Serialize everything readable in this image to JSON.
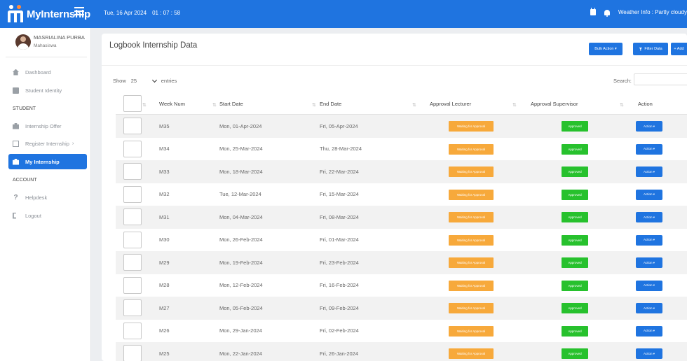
{
  "topbar": {
    "app_name": "MyInternship",
    "date": "Tue, 16 Apr 2024",
    "time": "01 : 07 : 58",
    "weather": "Weather Info : Partly cloudy"
  },
  "profile": {
    "name": "MASRIALINA PURBA",
    "role": "Mahasiswa"
  },
  "sidebar": {
    "items_main": [
      {
        "label": "Dashboard",
        "icon": "home-icon"
      },
      {
        "label": "Student Identity",
        "icon": "id-card-icon"
      }
    ],
    "section_student": "STUDENT",
    "items_student": [
      {
        "label": "Internship Offer",
        "icon": "briefcase-icon"
      },
      {
        "label": "Register Internship",
        "icon": "document-icon",
        "caret": "›"
      },
      {
        "label": "My Internship",
        "icon": "briefcase-icon",
        "active": true
      }
    ],
    "section_account": "ACCOUNT",
    "items_account": [
      {
        "label": "Helpdesk",
        "icon": "question-icon"
      },
      {
        "label": "Logout",
        "icon": "logout-icon"
      }
    ]
  },
  "main": {
    "title": "Logbook Internship Data",
    "bulk_action": "Bulk Action ▾",
    "filter_data": "Filter Data",
    "add": "+ Add",
    "show_label": "Show",
    "entries_value": "25",
    "entries_label": "entries",
    "search_label": "Search:"
  },
  "table": {
    "headers": [
      "Week Num",
      "Start Date",
      "End Date",
      "Approval Lecturer",
      "Approval Supervisor",
      "Action"
    ],
    "sort_glyph": "⇅",
    "status_waiting": "Waiting for Approval",
    "status_approved": "Approved",
    "action_label": "Action ▾",
    "rows": [
      {
        "week": "M35",
        "start": "Mon, 01-Apr-2024",
        "end": "Fri, 05-Apr-2024"
      },
      {
        "week": "M34",
        "start": "Mon, 25-Mar-2024",
        "end": "Thu, 28-Mar-2024"
      },
      {
        "week": "M33",
        "start": "Mon, 18-Mar-2024",
        "end": "Fri, 22-Mar-2024"
      },
      {
        "week": "M32",
        "start": "Tue, 12-Mar-2024",
        "end": "Fri, 15-Mar-2024"
      },
      {
        "week": "M31",
        "start": "Mon, 04-Mar-2024",
        "end": "Fri, 08-Mar-2024"
      },
      {
        "week": "M30",
        "start": "Mon, 26-Feb-2024",
        "end": "Fri, 01-Mar-2024"
      },
      {
        "week": "M29",
        "start": "Mon, 19-Feb-2024",
        "end": "Fri, 23-Feb-2024"
      },
      {
        "week": "M28",
        "start": "Mon, 12-Feb-2024",
        "end": "Fri, 16-Feb-2024"
      },
      {
        "week": "M27",
        "start": "Mon, 05-Feb-2024",
        "end": "Fri, 09-Feb-2024"
      },
      {
        "week": "M26",
        "start": "Mon, 29-Jan-2024",
        "end": "Fri, 02-Feb-2024"
      },
      {
        "week": "M25",
        "start": "Mon, 22-Jan-2024",
        "end": "Fri, 26-Jan-2024"
      }
    ]
  },
  "colors": {
    "primary": "#1f74e0",
    "waiting": "#f7a93b",
    "approved": "#27c12d"
  }
}
